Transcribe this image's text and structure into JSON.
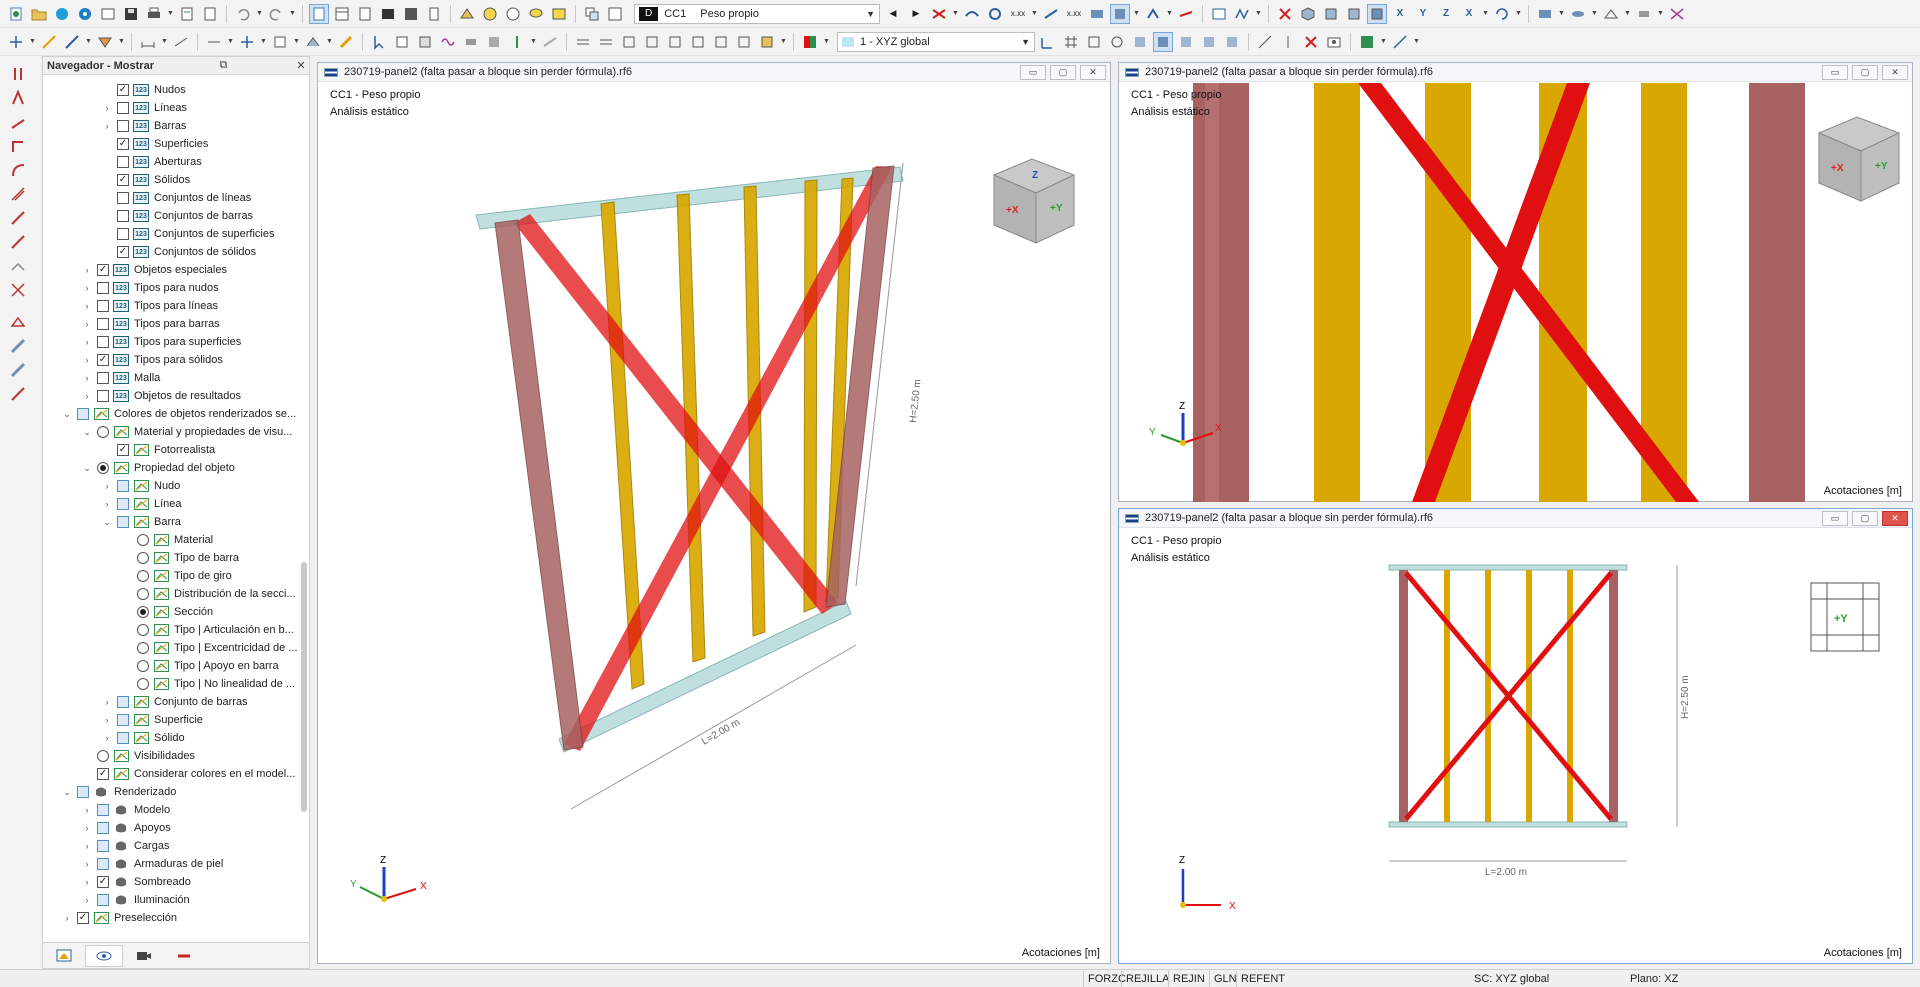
{
  "toolbar": {
    "combo_loadcase_tag": "D",
    "combo_loadcase_code": "CC1",
    "combo_loadcase_name": "Peso propio",
    "combo_coord_system": "1 - XYZ global"
  },
  "navigator": {
    "title": "Navegador - Mostrar",
    "items": [
      {
        "label": "Nudos"
      },
      {
        "label": "Líneas"
      },
      {
        "label": "Barras"
      },
      {
        "label": "Superficies"
      },
      {
        "label": "Aberturas"
      },
      {
        "label": "Sólidos"
      },
      {
        "label": "Conjuntos de líneas"
      },
      {
        "label": "Conjuntos de barras"
      },
      {
        "label": "Conjuntos de superficies"
      },
      {
        "label": "Conjuntos de sólidos"
      },
      {
        "label": "Objetos especiales"
      },
      {
        "label": "Tipos para nudos"
      },
      {
        "label": "Tipos para líneas"
      },
      {
        "label": "Tipos para barras"
      },
      {
        "label": "Tipos para superficies"
      },
      {
        "label": "Tipos para sólidos"
      },
      {
        "label": "Malla"
      },
      {
        "label": "Objetos de resultados"
      },
      {
        "label": "Colores de objetos renderizados se..."
      },
      {
        "label": "Material y propiedades de visu..."
      },
      {
        "label": "Fotorrealista"
      },
      {
        "label": "Propiedad del objeto"
      },
      {
        "label": "Nudo"
      },
      {
        "label": "Línea"
      },
      {
        "label": "Barra"
      },
      {
        "label": "Material"
      },
      {
        "label": "Tipo de barra"
      },
      {
        "label": "Tipo de giro"
      },
      {
        "label": "Distribución de la secci..."
      },
      {
        "label": "Sección"
      },
      {
        "label": "Tipo | Articulación en b..."
      },
      {
        "label": "Tipo | Excentricidad de ..."
      },
      {
        "label": "Tipo | Apoyo en barra"
      },
      {
        "label": "Tipo | No linealidad de ..."
      },
      {
        "label": "Conjunto de barras"
      },
      {
        "label": "Superficie"
      },
      {
        "label": "Sólido"
      },
      {
        "label": "Visibilidades"
      },
      {
        "label": "Considerar colores en el model..."
      },
      {
        "label": "Renderizado"
      },
      {
        "label": "Modelo"
      },
      {
        "label": "Apoyos"
      },
      {
        "label": "Cargas"
      },
      {
        "label": "Armaduras de piel"
      },
      {
        "label": "Sombreado"
      },
      {
        "label": "Iluminación"
      },
      {
        "label": "Preselección"
      }
    ]
  },
  "viewports": {
    "v1": {
      "title": "230719-panel2 (falta pasar a bloque sin perder fórmula).rf6",
      "line1": "CC1 - Peso propio",
      "line2": "Análisis estático",
      "footer": "Acotaciones [m]",
      "dim_h": "H=2.50 m",
      "dim_l": "L=2.00 m"
    },
    "v2": {
      "title": "230719-panel2 (falta pasar a bloque sin perder fórmula).rf6",
      "line1": "CC1 - Peso propio",
      "line2": "Análisis estático",
      "footer": "Acotaciones [m]"
    },
    "v3": {
      "title": "230719-panel2 (falta pasar a bloque sin perder fórmula).rf6",
      "line1": "CC1 - Peso propio",
      "line2": "Análisis estático",
      "footer": "Acotaciones [m]",
      "dim_h": "H=2.50 m",
      "dim_l": "L=2.00 m",
      "view_cube": "+Y"
    }
  },
  "axes": {
    "x": "X",
    "y": "Y",
    "z": "Z"
  },
  "cube_labels": {
    "z": "Z",
    "x": "+X",
    "y": "+Y"
  },
  "status_bar": {
    "buttons": [
      "FORZC",
      "REJILLA",
      "REJIN",
      "GLN",
      "REFENT"
    ],
    "coord_system": "SC: XYZ global",
    "plane": "Plano: XZ"
  },
  "colors": {
    "column_dark": "#a86262",
    "column_yellow": "#d8a800",
    "brace_red": "#e01010",
    "beam_cyan": "#aad4d4"
  }
}
